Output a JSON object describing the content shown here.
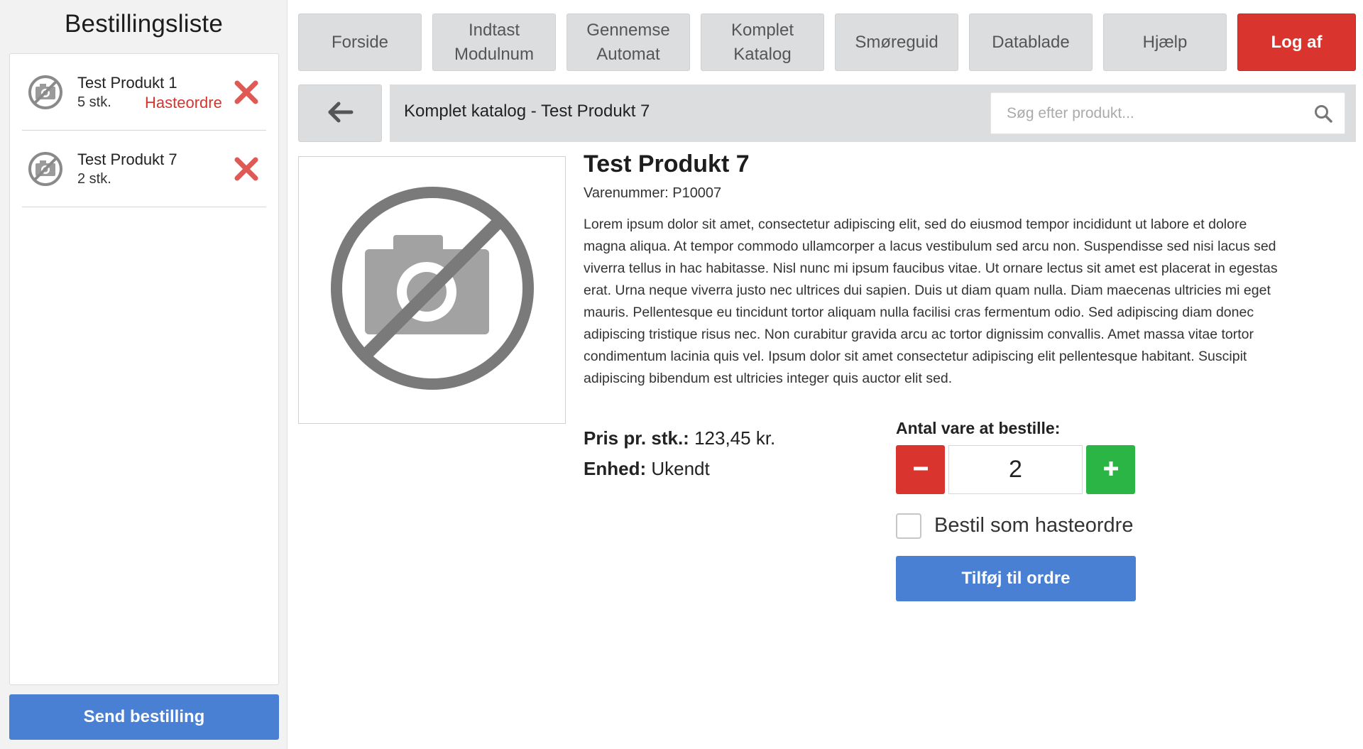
{
  "sidebar": {
    "title": "Bestillingsliste",
    "items": [
      {
        "name": "Test Produkt 1",
        "qty": "5 stk.",
        "rush": "Hasteordre"
      },
      {
        "name": "Test Produkt 7",
        "qty": "2 stk.",
        "rush": ""
      }
    ],
    "send_label": "Send bestilling"
  },
  "nav": {
    "items": [
      {
        "label": "Forside"
      },
      {
        "label": "Indtast\nModulnum"
      },
      {
        "label": "Gennemse\nAutomat"
      },
      {
        "label": "Komplet\nKatalog"
      },
      {
        "label": "Smøreguid"
      },
      {
        "label": "Datablade"
      },
      {
        "label": "Hjælp"
      }
    ],
    "logout_label": "Log af"
  },
  "breadcrumb": {
    "title": "Komplet katalog - Test Produkt 7"
  },
  "search": {
    "placeholder": "Søg efter produkt...",
    "value": ""
  },
  "product": {
    "title": "Test Produkt 7",
    "sku": "Varenummer: P10007",
    "description": "Lorem ipsum dolor sit amet, consectetur adipiscing elit, sed do eiusmod tempor incididunt ut labore et dolore magna aliqua. At tempor commodo ullamcorper a lacus vestibulum sed arcu non. Suspendisse sed nisi lacus sed viverra tellus in hac habitasse. Nisl nunc mi ipsum faucibus vitae. Ut ornare lectus sit amet est placerat in egestas erat. Urna neque viverra justo nec ultrices dui sapien. Duis ut diam quam nulla. Diam maecenas ultricies mi eget mauris. Pellentesque eu tincidunt tortor aliquam nulla facilisi cras fermentum odio. Sed adipiscing diam donec adipiscing tristique risus nec. Non curabitur gravida arcu ac tortor dignissim convallis. Amet massa vitae tortor condimentum lacinia quis vel. Ipsum dolor sit amet consectetur adipiscing elit pellentesque habitant. Suscipit adipiscing bibendum est ultricies integer quis auctor elit sed.",
    "price_label": "Pris pr. stk.:",
    "price_value": "123,45 kr.",
    "unit_label": "Enhed:",
    "unit_value": "Ukendt"
  },
  "order": {
    "qty_label": "Antal vare at bestille:",
    "qty_value": "2",
    "rush_label": "Bestil som hasteordre",
    "rush_checked": false,
    "add_label": "Tilføj til ordre"
  },
  "icons": {
    "no_image": "no-photo-icon",
    "remove": "close-x-icon",
    "back": "arrow-left-icon",
    "search": "magnifier-icon",
    "minus": "minus-icon",
    "plus": "plus-icon"
  },
  "colors": {
    "danger": "#d9342d",
    "success": "#2bb544",
    "primary": "#4a80d4",
    "remove_x": "#e05a55",
    "nav_bg": "#dcdddf"
  }
}
